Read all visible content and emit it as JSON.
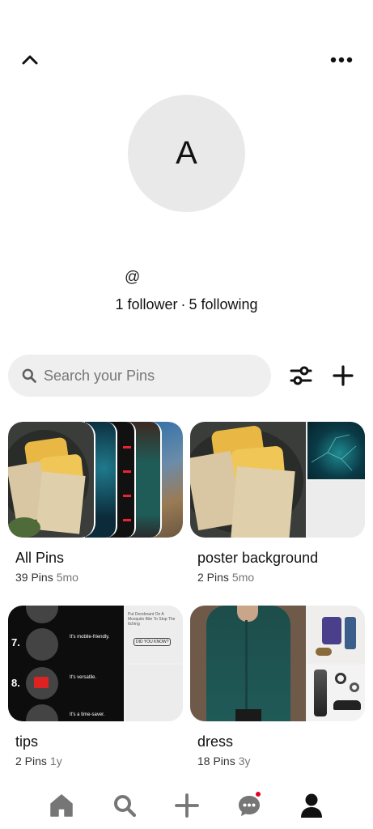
{
  "profile": {
    "avatar_letter": "A",
    "handle": "@",
    "followers": "1 follower",
    "separator": "·",
    "following": "5 following"
  },
  "search": {
    "placeholder": "Search your Pins"
  },
  "boards": [
    {
      "title": "All Pins",
      "pins": "39 Pins",
      "age": "5mo"
    },
    {
      "title": "poster background",
      "pins": "2 Pins",
      "age": "5mo"
    },
    {
      "title": "tips",
      "pins": "2 Pins",
      "age": "1y"
    },
    {
      "title": "dress",
      "pins": "18 Pins",
      "age": "3y"
    }
  ],
  "tips_card": {
    "item7_num": "7.",
    "item7_text": "It's mobile-friendly.",
    "item8_num": "8.",
    "item8_text": "It's versatile.",
    "item9_text": "It's a time-saver.",
    "side_text": "Put Deodorant On A Mosquito Bite To Stop The Itching",
    "side_badge": "DID YOU KNOW?"
  },
  "icons": {
    "back": "chevron-up-icon",
    "more": "more-dots-icon",
    "search": "search-icon",
    "filter": "filter-sliders-icon",
    "add": "plus-icon",
    "nav_home": "home-icon",
    "nav_search": "search-icon",
    "nav_create": "plus-icon",
    "nav_messages": "chat-icon",
    "nav_profile": "profile-icon"
  },
  "colors": {
    "accent": "#e60023",
    "search_bg": "#efefef",
    "avatar_bg": "#e9e9e9"
  }
}
